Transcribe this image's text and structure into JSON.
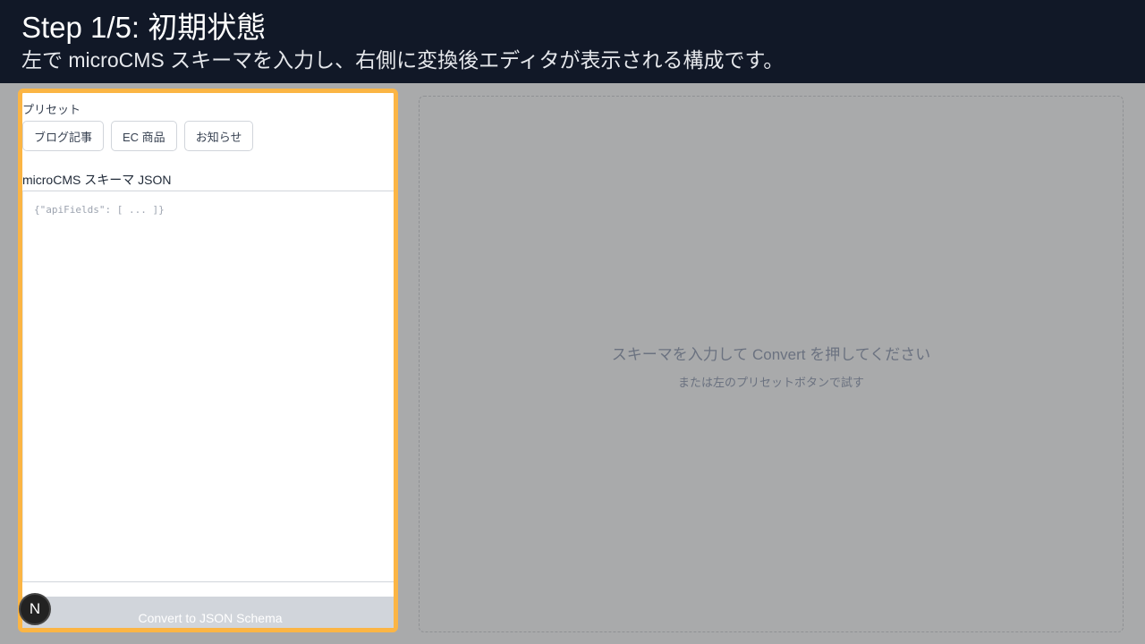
{
  "header": {
    "title": "Step 1/5: 初期状態",
    "subtitle": "左で microCMS スキーマを入力し、右側に変換後エディタが表示される構成です。"
  },
  "left": {
    "preset_label": "プリセット",
    "presets": [
      "ブログ記事",
      "EC 商品",
      "お知らせ"
    ],
    "json_label": "microCMS スキーマ JSON",
    "json_placeholder": "{\"apiFields\": [ ... ]}",
    "convert_label": "Convert to JSON Schema"
  },
  "badge": "N",
  "right": {
    "message": "スキーマを入力して Convert を押してください",
    "hint": "または左のプリセットボタンで試す"
  }
}
